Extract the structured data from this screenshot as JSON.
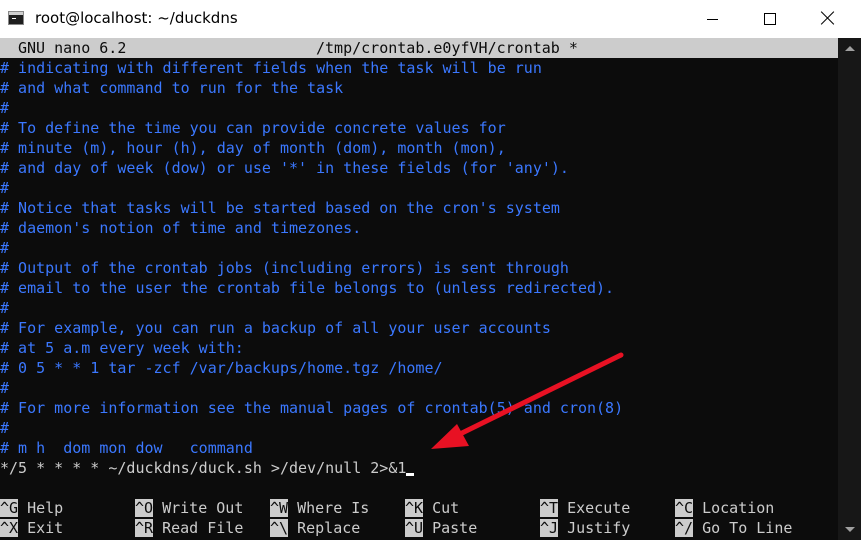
{
  "window": {
    "title": "root@localhost: ~/duckdns"
  },
  "nano": {
    "version": "GNU nano 6.2",
    "filename": "/tmp/crontab.e0yfVH/crontab *"
  },
  "lines": [
    "# indicating with different fields when the task will be run",
    "# and what command to run for the task",
    "#",
    "# To define the time you can provide concrete values for",
    "# minute (m), hour (h), day of month (dom), month (mon),",
    "# and day of week (dow) or use '*' in these fields (for 'any').",
    "#",
    "# Notice that tasks will be started based on the cron's system",
    "# daemon's notion of time and timezones.",
    "#",
    "# Output of the crontab jobs (including errors) is sent through",
    "# email to the user the crontab file belongs to (unless redirected).",
    "#",
    "# For example, you can run a backup of all your user accounts",
    "# at 5 a.m every week with:",
    "# 0 5 * * 1 tar -zcf /var/backups/home.tgz /home/",
    "#",
    "# For more information see the manual pages of crontab(5) and cron(8)",
    "#",
    "# m h  dom mon dow   command"
  ],
  "command_line": "*/5 * * * * ~/duckdns/duck.sh >/dev/null 2>&1",
  "shortcuts": {
    "row1": [
      {
        "key": "^G",
        "label": " Help"
      },
      {
        "key": "^O",
        "label": " Write Out"
      },
      {
        "key": "^W",
        "label": " Where Is"
      },
      {
        "key": "^K",
        "label": " Cut"
      },
      {
        "key": "^T",
        "label": " Execute"
      },
      {
        "key": "^C",
        "label": " Location"
      }
    ],
    "row2": [
      {
        "key": "^X",
        "label": " Exit"
      },
      {
        "key": "^R",
        "label": " Read File"
      },
      {
        "key": "^\\",
        "label": " Replace"
      },
      {
        "key": "^U",
        "label": " Paste"
      },
      {
        "key": "^J",
        "label": " Justify"
      },
      {
        "key": "^/",
        "label": " Go To Line"
      }
    ]
  },
  "colors": {
    "comment": "#3b78ff",
    "arrow": "#e81123"
  }
}
